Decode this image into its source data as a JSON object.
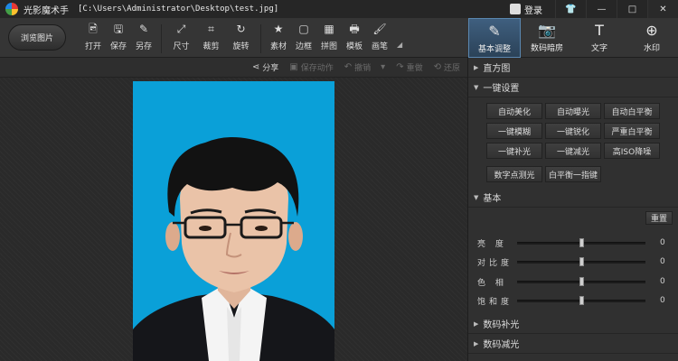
{
  "window": {
    "app_name": "光影魔术手",
    "path": "[C:\\Users\\Administrator\\Desktop\\test.jpg]",
    "login_label": "登录",
    "btn_skin": "👕",
    "btn_minimize": "—",
    "btn_maximize": "□",
    "btn_close": "✕"
  },
  "toolbar": {
    "browse_label": "浏览图片",
    "tools": [
      {
        "label": "打开",
        "icon": "open-icon"
      },
      {
        "label": "保存",
        "icon": "save-icon"
      },
      {
        "label": "另存",
        "icon": "save-as-icon"
      },
      {
        "label": "尺寸",
        "icon": "resize-icon"
      },
      {
        "label": "裁剪",
        "icon": "crop-icon"
      },
      {
        "label": "旋转",
        "icon": "rotate-icon"
      },
      {
        "label": "素材",
        "icon": "material-icon"
      },
      {
        "label": "边框",
        "icon": "border-icon"
      },
      {
        "label": "拼图",
        "icon": "collage-icon"
      },
      {
        "label": "模板",
        "icon": "template-icon"
      },
      {
        "label": "画笔",
        "icon": "brush-icon"
      }
    ]
  },
  "tabs": [
    {
      "label": "基本调整",
      "icon": "basic-adjust-icon",
      "active": true
    },
    {
      "label": "数码暗房",
      "icon": "darkroom-icon",
      "active": false
    },
    {
      "label": "文字",
      "icon": "text-icon",
      "active": false
    },
    {
      "label": "水印",
      "icon": "watermark-icon",
      "active": false
    }
  ],
  "actions": {
    "share": "分享",
    "save_action": "保存动作",
    "undo": "撤销",
    "redo": "重做",
    "restore": "还原"
  },
  "panel": {
    "histogram": "直方图",
    "quick_settings": "一键设置",
    "quick_buttons": [
      "自动美化",
      "自动曝光",
      "自动白平衡",
      "一键模糊",
      "一键锐化",
      "严重白平衡",
      "一键补光",
      "一键减光",
      "高ISO降噪"
    ],
    "quick_buttons_row2": [
      "数字点测光",
      "白平衡一指键"
    ],
    "basic": "基本",
    "reset": "重置",
    "sliders": [
      {
        "name": "亮 度",
        "value": 0,
        "level_percent": 50
      },
      {
        "name": "对比度",
        "value": 0,
        "level_percent": 50
      },
      {
        "name": "色 相",
        "value": 0,
        "level_percent": 50
      },
      {
        "name": "饱和度",
        "value": 0,
        "level_percent": 50
      }
    ],
    "digital_fill_light": "数码补光",
    "next_section": "数码减光"
  },
  "colors": {
    "photo_background": "#0aa0d8",
    "active_tab": "#3f5f7f"
  }
}
